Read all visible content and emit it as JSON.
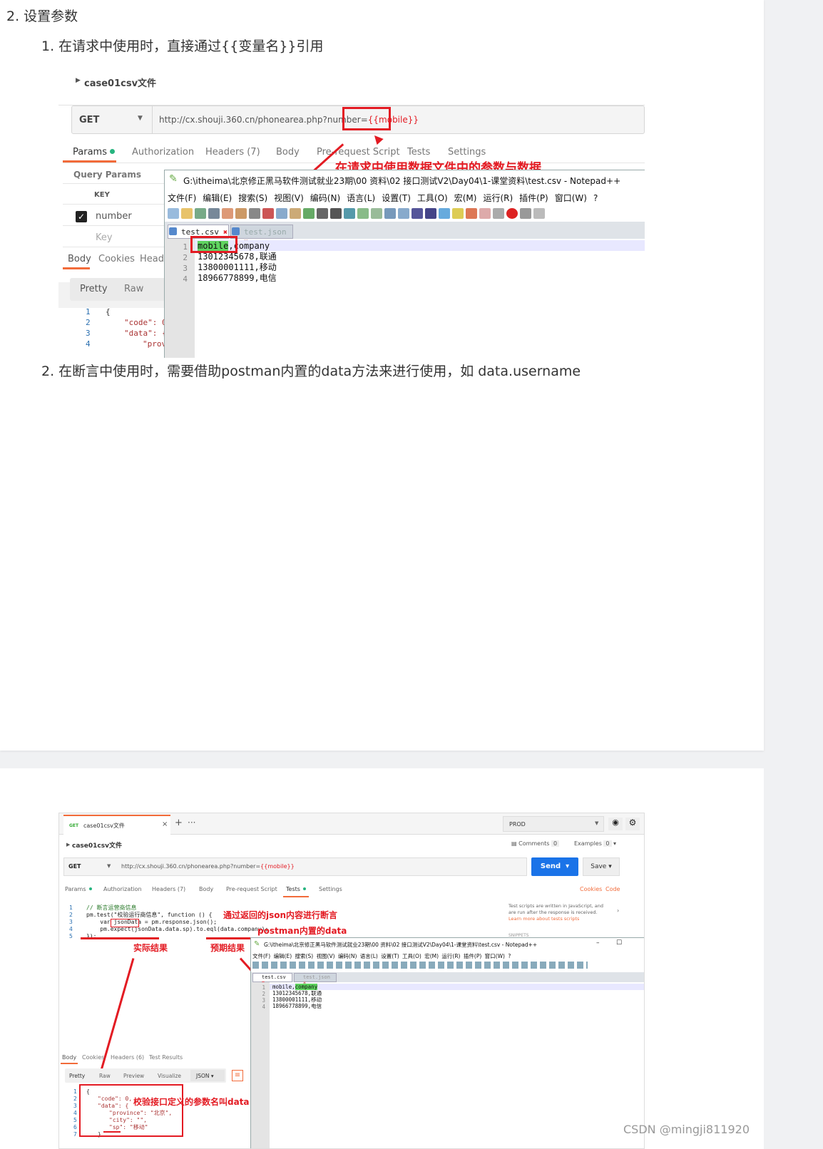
{
  "article": {
    "heading": "2. 设置参数",
    "item1": "1. 在请求中使用时，直接通过{{变量名}}引用",
    "item2": "2. 在断言中使用时，需要借助postman内置的data方法来进行使用，如 data.username"
  },
  "shot1": {
    "collection": "case01csv文件",
    "method": "GET",
    "url_prefix": "http://cx.shouji.360.cn/phonearea.php?number=",
    "url_var": "{{mobile}}",
    "tabs": [
      "Params",
      "Authorization",
      "Headers (7)",
      "Body",
      "Pre-request Script",
      "Tests",
      "Settings"
    ],
    "query_params": "Query Params",
    "key_header": "KEY",
    "param_name": "number",
    "key_placeholder": "Key",
    "resp_tabs": [
      "Body",
      "Cookies",
      "Heade"
    ],
    "view_tabs": [
      "Pretty",
      "Raw"
    ],
    "resp_lines": [
      "{",
      "\"code\": 0",
      "\"data\": {",
      "\"prov"
    ],
    "annotation": "在请求中使用数据文件中的参数与数据",
    "notepad_title": "G:\\itheima\\北京修正黑马软件测试就业23期\\00 资料\\02 接口测试V2\\Day04\\1-课堂资料\\test.csv - Notepad++",
    "notepad_menu": [
      "文件(F)",
      "编辑(E)",
      "搜索(S)",
      "视图(V)",
      "编码(N)",
      "语言(L)",
      "设置(T)",
      "工具(O)",
      "宏(M)",
      "运行(R)",
      "插件(P)",
      "窗口(W)",
      "?"
    ],
    "file_tabs": [
      "test.csv",
      "test.json"
    ],
    "csv_header_a": "mobile",
    "csv_header_b": ",company",
    "csv_rows": [
      "13012345678,联通",
      "13800001111,移动",
      "18966778899,电信"
    ]
  },
  "shot2": {
    "tab_method": "GET",
    "tab_name": "case01csv文件",
    "env": "PROD",
    "collection": "case01csv文件",
    "comments": "Comments",
    "comments_count": "0",
    "examples": "Examples",
    "examples_count": "0",
    "method": "GET",
    "url_prefix": "http://cx.shouji.360.cn/phonearea.php?number=",
    "url_var": "{{mobile}}",
    "send": "Send",
    "save": "Save",
    "tabs": [
      "Params",
      "Authorization",
      "Headers (7)",
      "Body",
      "Pre-request Script",
      "Tests",
      "Settings"
    ],
    "cookies": "Cookies",
    "code": "Code",
    "script_lines": [
      "// 断言运营商信息",
      "pm.test(\"校验运行商信息\", function () {",
      "    var jsonData = pm.response.json();",
      "    pm.expect(jsonData.data.sp).to.eql(data.company);",
      "});"
    ],
    "side_text": "Test scripts are written in JavaScript, and are run after the response is received.",
    "side_link": "Learn more about tests scripts",
    "snippets": "SNIPPETS",
    "anno_json": "通过返回的json内容进行断言",
    "anno_data": "postman内置的data",
    "anno_actual": "实际结果",
    "anno_expected": "预期结果",
    "anno_param": "校验接口定义的参数名叫data",
    "resp_tabs": [
      "Body",
      "Cookies",
      "Headers (6)",
      "Test Results"
    ],
    "view_tabs": [
      "Pretty",
      "Raw",
      "Preview",
      "Visualize",
      "JSON"
    ],
    "resp_lines": [
      "{",
      "\"code\": 0,",
      "\"data\": {",
      "\"province\": \"北京\",",
      "\"city\": \"\",",
      "\"sp\": \"移动\"",
      "}"
    ],
    "notepad_title": "G:\\itheima\\北京修正黑马软件测试就业23期\\00 资料\\02 接口测试V2\\Day04\\1-课堂资料\\test.csv - Notepad++",
    "file_tabs": [
      "test.csv",
      "test.json"
    ],
    "csv_header_a": "mobile,",
    "csv_header_b": "company",
    "csv_rows": [
      "13012345678,联通",
      "13800001111,移动",
      "18966778899,电信"
    ]
  },
  "watermark": "CSDN @mingji811920"
}
